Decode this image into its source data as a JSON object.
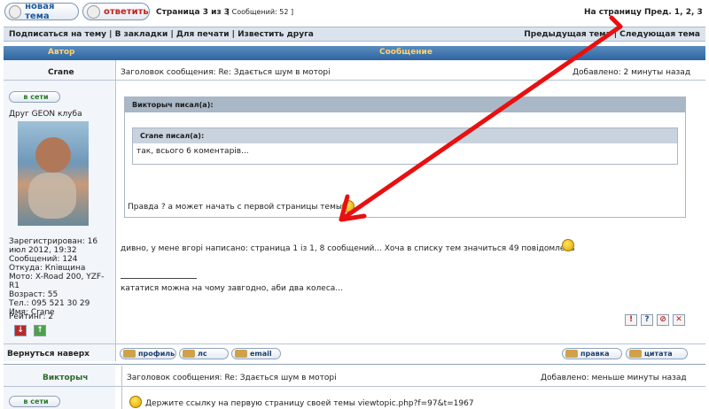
{
  "top": {
    "new_topic": "новая тема",
    "reply": "ответить",
    "page_info": "Страница 3 из 3",
    "message_count": "[ Сообщений: 52 ]",
    "goto_page": "На страницу Пред. 1, 2, 3"
  },
  "toolbar": {
    "links": "Подписаться на тему | В закладки | Для печати | Известить друга",
    "nav": "Предыдущая тема | Следующая тема"
  },
  "table": {
    "col_author": "Автор",
    "col_message": "Сообщение"
  },
  "post1": {
    "author": "Crane",
    "subject": "Заголовок сообщения: Re: Здається шум в моторі",
    "added": "Добавлено: 2 минуты назад",
    "online": "в сети",
    "rank": "Друг GEON клуба",
    "registered": "Зарегистрирован: 16 июл 2012, 19:32",
    "messages": "Сообщений: 124",
    "from": "Откуда: Кnівщина",
    "moto": "Мото: X-Road 200, YZF-R1",
    "age": "Возраст: 55",
    "phone": "Тел.: 095 521 30 29",
    "name": "Имя: Crane",
    "rating": "Рейтинг: 2",
    "quote_outer_head": "Викторыч писал(а):",
    "quote_inner_head": "Crane писал(а):",
    "quote_inner_text": "так, всього 6 коментарів...",
    "quote_outer_text": "Правда ? а может начать с первой страницы темы ?",
    "body": "дивно, у мене вгорі написано: страница 1 із 1, 8 сообщений... Хоча в списку тем значиться 49 повідомлень",
    "signature": "кататися можна на чому завгодно, аби два колеса..."
  },
  "actions": {
    "back_top": "Вернуться наверх",
    "profile": "профиль",
    "pm": "лс",
    "email": "email",
    "edit": "правка",
    "quote": "цитата"
  },
  "post2": {
    "author": "Викторыч",
    "subject": "Заголовок сообщения: Re: Здається шум в моторі",
    "added": "Добавлено: меньше минуты назад",
    "online": "в сети",
    "body": "Держите ссылку на первую страницу своей темы viewtopic.php?f=97&t=1967"
  },
  "colors": {
    "header_blue": "#2e65a0",
    "header_text": "#ffd26a",
    "arrow": "#e81010"
  }
}
